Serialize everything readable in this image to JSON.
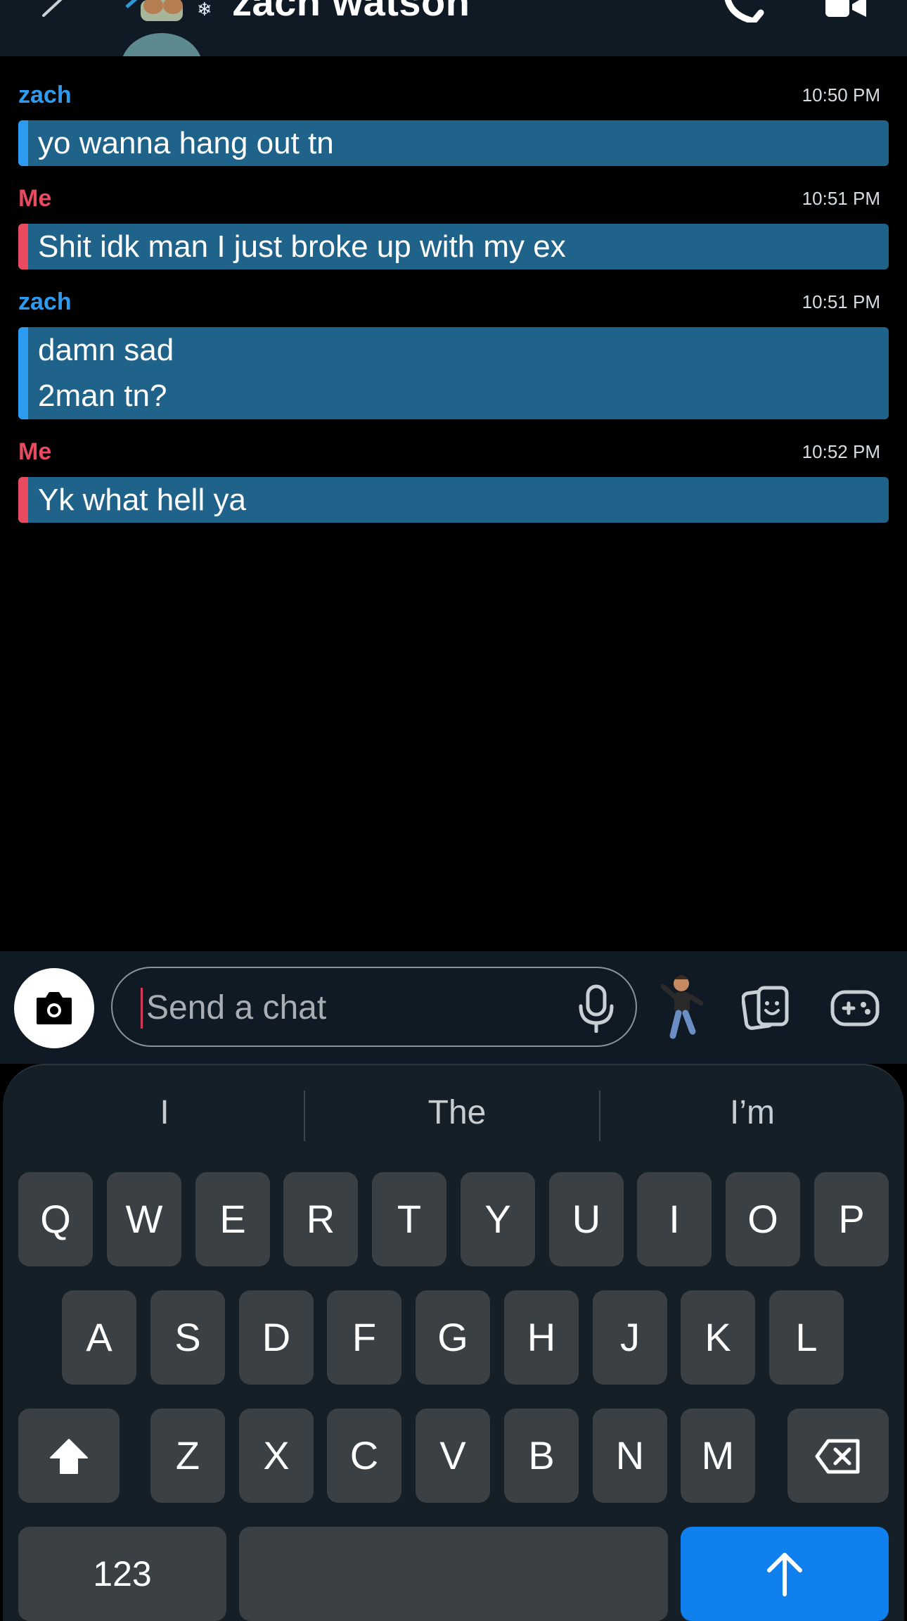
{
  "header": {
    "contact_name": "zach watson",
    "icons": {
      "back": "chevron-left-icon",
      "call": "phone-icon",
      "video": "video-camera-icon"
    }
  },
  "messages": [
    {
      "sender": "zach",
      "time": "10:50 PM",
      "lines": [
        "yo wanna hang out tn"
      ],
      "color": "#2d9cf0"
    },
    {
      "sender": "Me",
      "time": "10:51 PM",
      "lines": [
        "Shit idk man I just broke up with my ex"
      ],
      "color": "#e84a5f"
    },
    {
      "sender": "zach",
      "time": "10:51 PM",
      "lines": [
        "damn sad",
        "2man tn?"
      ],
      "color": "#2d9cf0"
    },
    {
      "sender": "Me",
      "time": "10:52 PM",
      "lines": [
        "Yk what hell ya"
      ],
      "color": "#e84a5f"
    }
  ],
  "composer": {
    "placeholder": "Send a chat",
    "value": ""
  },
  "keyboard": {
    "suggestions": [
      "I",
      "The",
      "I’m"
    ],
    "row1": [
      "Q",
      "W",
      "E",
      "R",
      "T",
      "Y",
      "U",
      "I",
      "O",
      "P"
    ],
    "row2": [
      "A",
      "S",
      "D",
      "F",
      "G",
      "H",
      "J",
      "K",
      "L"
    ],
    "row3": [
      "Z",
      "X",
      "C",
      "V",
      "B",
      "N",
      "M"
    ],
    "numbers_label": "123"
  },
  "colors": {
    "bubble": "#20638a",
    "zach": "#2d9cf0",
    "me": "#e84a5f",
    "send_key": "#0f80ee"
  }
}
